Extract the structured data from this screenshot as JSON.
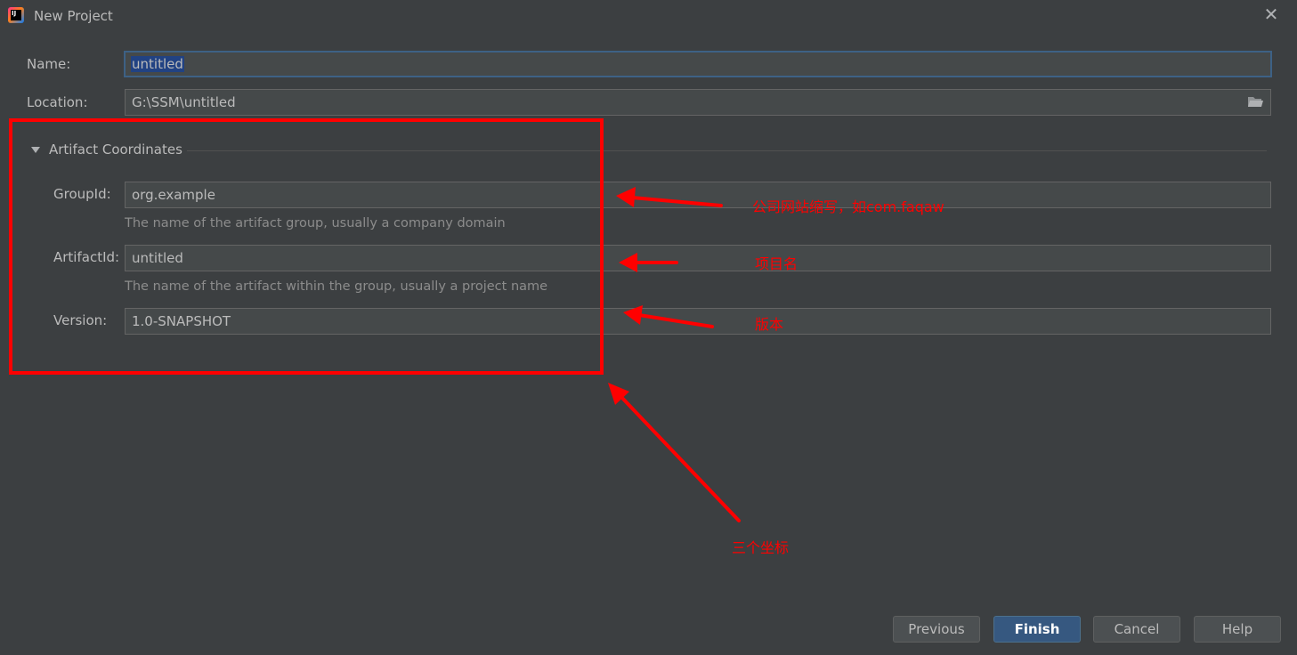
{
  "window": {
    "title": "New Project"
  },
  "form": {
    "name_label": "Name:",
    "name_value": "untitled",
    "location_label": "Location:",
    "location_value": "G:\\SSM\\untitled"
  },
  "artifact": {
    "section_title": "Artifact Coordinates",
    "group_label": "GroupId:",
    "group_value": "org.example",
    "group_hint": "The name of the artifact group, usually a company domain",
    "artifact_label": "ArtifactId:",
    "artifact_value": "untitled",
    "artifact_hint": "The name of the artifact within the group, usually a project name",
    "version_label": "Version:",
    "version_value": "1.0-SNAPSHOT"
  },
  "annotations": {
    "group_note": "公司网站缩写，如com.faqaw",
    "artifact_note": "项目名",
    "version_note": "版本",
    "box_note": "三个坐标",
    "color": "#ff0000"
  },
  "buttons": {
    "previous": "Previous",
    "finish": "Finish",
    "cancel": "Cancel",
    "help": "Help"
  },
  "icons": {
    "app": "intellij-icon",
    "close": "close-icon",
    "folder": "folder-icon",
    "collapse": "triangle-down-icon"
  }
}
